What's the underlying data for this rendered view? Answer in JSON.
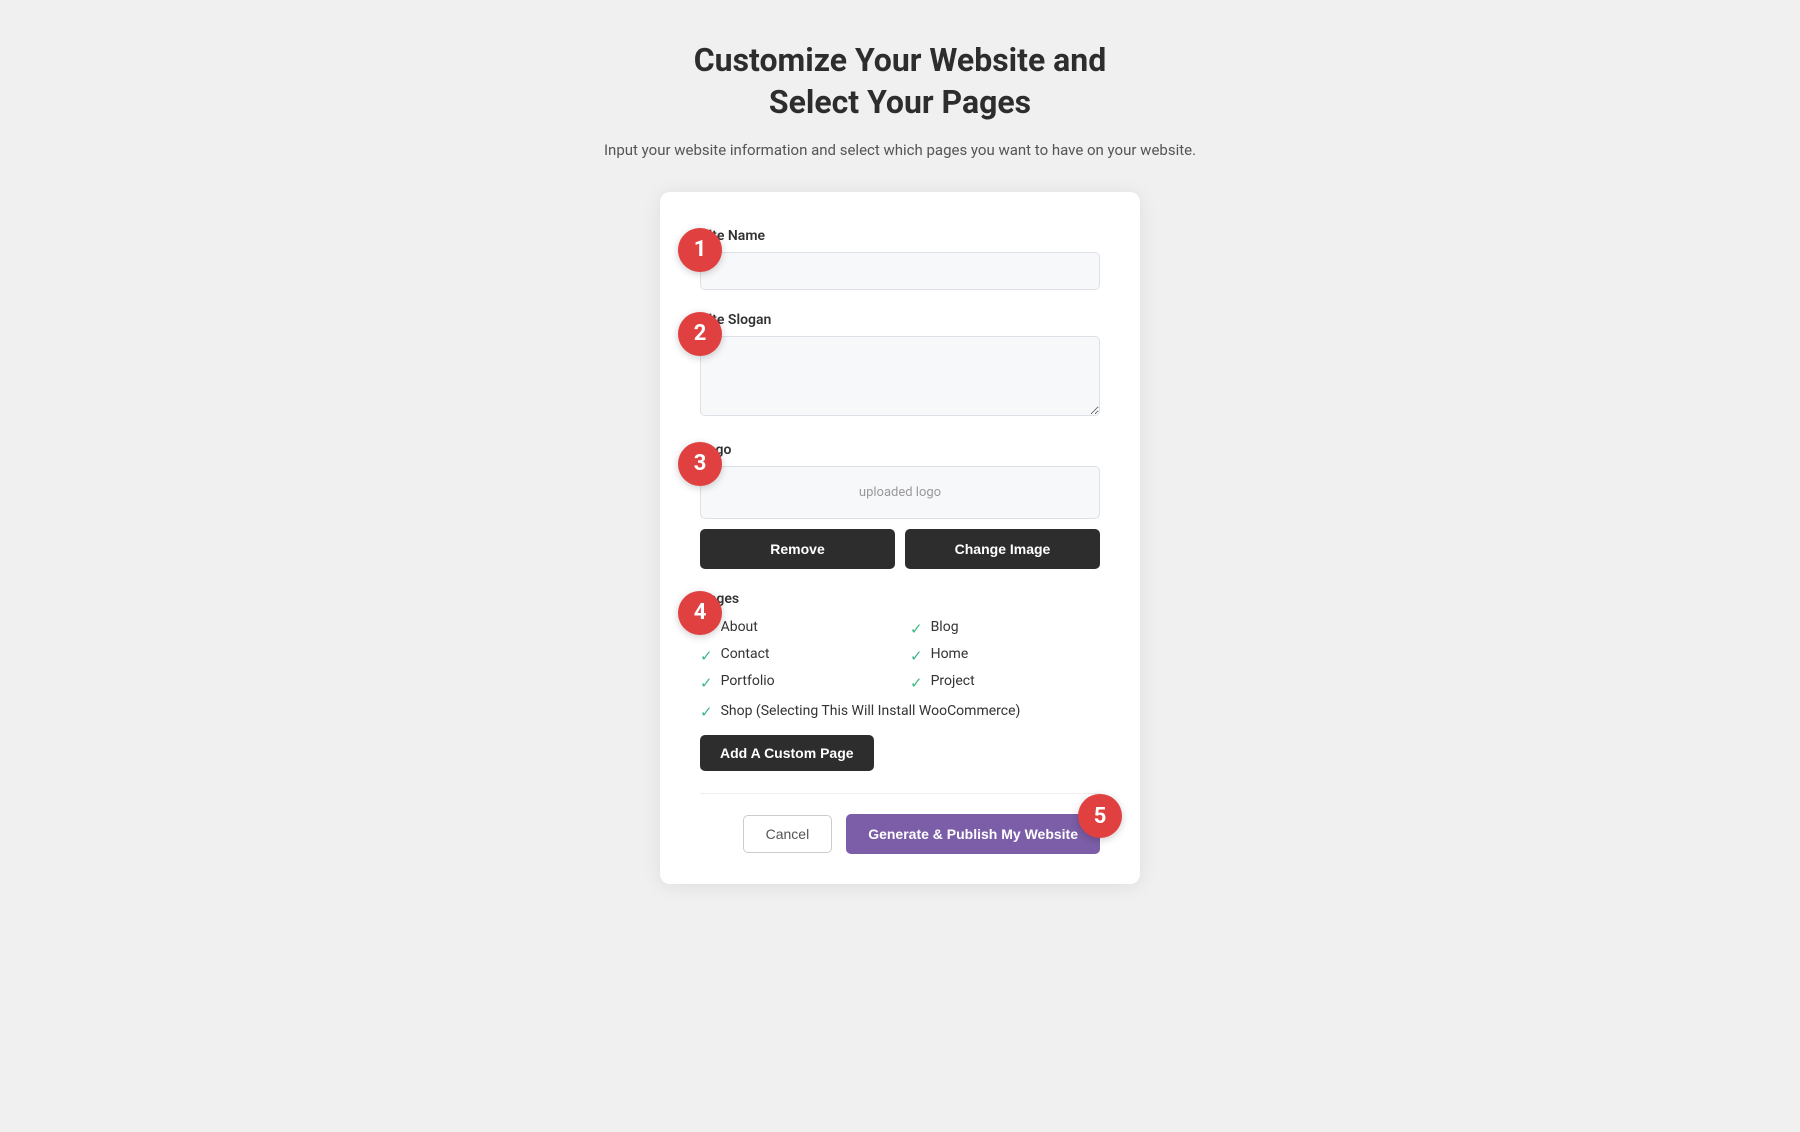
{
  "page": {
    "title_line1": "Customize Your Website and",
    "title_line2": "Select Your Pages",
    "subtitle": "Input your website information and select which pages you want to have on your website."
  },
  "steps": {
    "step1": "1",
    "step2": "2",
    "step3": "3",
    "step4": "4",
    "step5": "5"
  },
  "form": {
    "site_name_label": "Site Name",
    "site_name_placeholder": "",
    "site_slogan_label": "Site Slogan",
    "site_slogan_placeholder": "",
    "logo_label": "Logo",
    "logo_placeholder": "uploaded logo",
    "remove_button": "Remove",
    "change_image_button": "Change Image",
    "pages_label": "Pages",
    "pages": [
      {
        "name": "About",
        "checked": true
      },
      {
        "name": "Blog",
        "checked": true
      },
      {
        "name": "Contact",
        "checked": true
      },
      {
        "name": "Home",
        "checked": true
      },
      {
        "name": "Portfolio",
        "checked": true
      },
      {
        "name": "Project",
        "checked": true
      }
    ],
    "shop_page_label": "Shop (Selecting This Will Install WooCommerce)",
    "shop_checked": true,
    "add_custom_page_button": "Add A Custom Page",
    "cancel_button": "Cancel",
    "publish_button": "Generate & Publish My Website"
  }
}
